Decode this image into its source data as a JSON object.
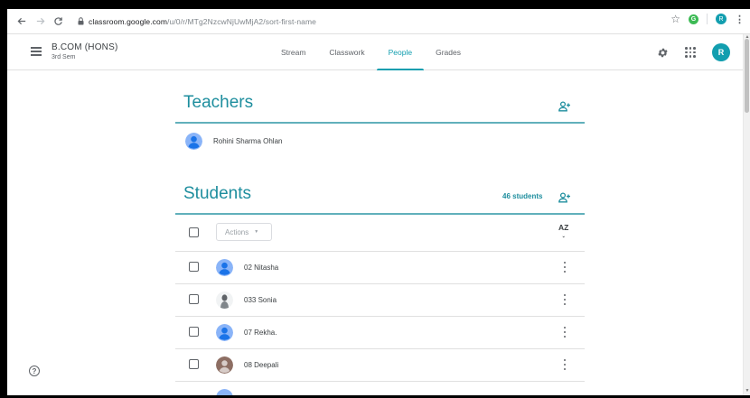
{
  "browser": {
    "url_domain": "classroom.google.com",
    "url_path": "/u/0/r/MTg2NzcwNjUwMjA2/sort-first-name",
    "profile_initial": "R",
    "extension_letter": "G"
  },
  "header": {
    "class_name": "B.COM (HONS)",
    "class_section": "3rd Sem",
    "avatar_initial": "R"
  },
  "tabs": [
    {
      "label": "Stream",
      "active": false
    },
    {
      "label": "Classwork",
      "active": false
    },
    {
      "label": "People",
      "active": true
    },
    {
      "label": "Grades",
      "active": false
    }
  ],
  "teachers": {
    "title": "Teachers",
    "list": [
      {
        "name": "Rohini Sharma Ohlan",
        "avatar": "default-person-icon"
      }
    ]
  },
  "students": {
    "title": "Students",
    "count_label": "46 students",
    "actions_label": "Actions",
    "sort_label": "AZ",
    "list": [
      {
        "name": "02 Nitasha",
        "avatar": "default-person-icon"
      },
      {
        "name": "033 Sonia",
        "avatar": "photo-silhouette"
      },
      {
        "name": "07 Rekha.",
        "avatar": "default-person-icon"
      },
      {
        "name": "08 Deepali",
        "avatar": "photo-brown"
      }
    ]
  },
  "colors": {
    "accent": "#1e8e9e",
    "tab_active": "#129eaf",
    "default_avatar": "#8ab4f8"
  }
}
